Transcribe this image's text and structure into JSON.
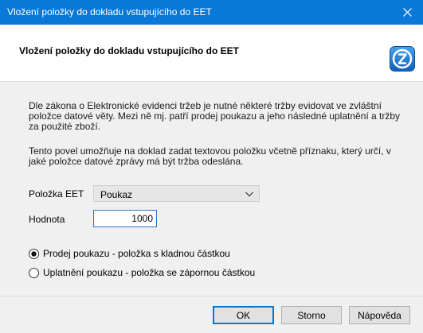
{
  "window": {
    "title": "Vložení položky do dokladu vstupujícího do EET"
  },
  "header": {
    "title": "Vložení položky do dokladu vstupujícího do EET",
    "logo_icon": "z-logo-icon",
    "accent": "#1a6dc4"
  },
  "content": {
    "paragraph1": "Dle zákona o Elektronické evidenci tržeb je nutné některé tržby evidovat ve zvláštní položce datové věty. Mezi ně mj. patří prodej poukazu a jeho následné uplatnění a tržby za použité zboží.",
    "paragraph2": "Tento povel umožňuje na doklad zadat textovou položku včetně příznaku, který určí, v jaké položce datové zprávy má být tržba odeslána.",
    "eet_label": "Položka EET",
    "eet_value": "Poukaz",
    "value_label": "Hodnota",
    "value": "1000",
    "radio_options": [
      {
        "label": "Prodej poukazu - položka s kladnou částkou",
        "selected": true
      },
      {
        "label": "Uplatnění poukazu - položka se zápornou částkou",
        "selected": false
      }
    ]
  },
  "footer": {
    "ok": "OK",
    "cancel": "Storno",
    "help": "Nápověda"
  },
  "colors": {
    "titlebar": "#0a78d7",
    "dialog_bg": "#f0f0f0"
  }
}
